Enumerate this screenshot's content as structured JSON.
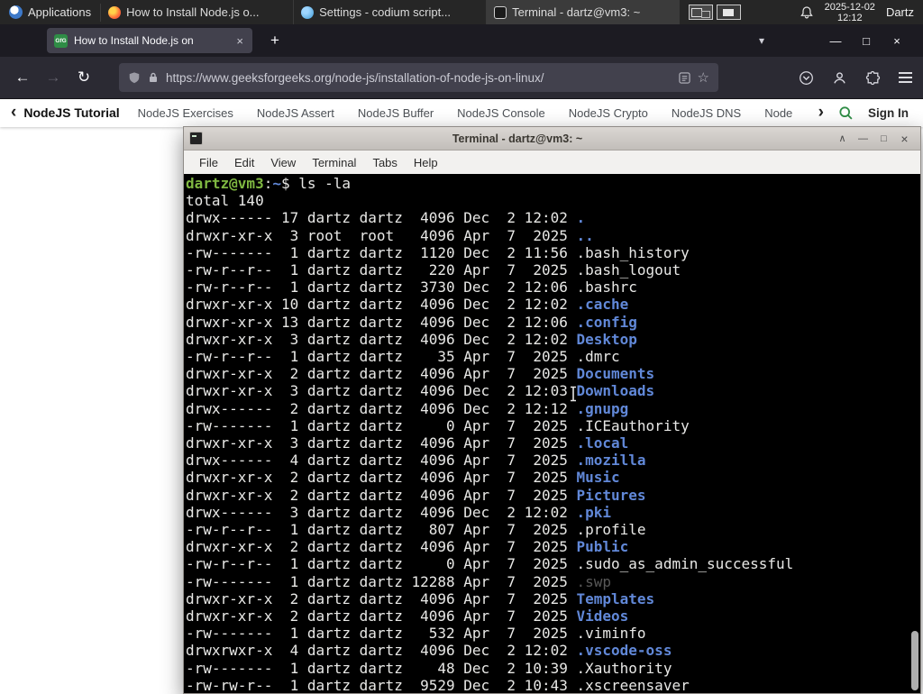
{
  "panel": {
    "applications_label": "Applications",
    "tasks": [
      {
        "title": "How to Install Node.js o...",
        "app": "firefox"
      },
      {
        "title": "Settings - codium script...",
        "app": "codium"
      },
      {
        "title": "Terminal - dartz@vm3: ~",
        "app": "terminal"
      }
    ],
    "clock": {
      "date": "2025-12-02",
      "time": "12:12"
    },
    "user": "Dartz"
  },
  "browser": {
    "tab": {
      "title": "How to Install Node.js on",
      "favicon": "GfG"
    },
    "url": "https://www.geeksforgeeks.org/node-js/installation-of-node-js-on-linux/"
  },
  "site_nav": {
    "active": "NodeJS Tutorial",
    "items": [
      "NodeJS Exercises",
      "NodeJS Assert",
      "NodeJS Buffer",
      "NodeJS Console",
      "NodeJS Crypto",
      "NodeJS DNS",
      "Node"
    ],
    "sign_in": "Sign In"
  },
  "terminal": {
    "window_title": "Terminal - dartz@vm3: ~",
    "menu": [
      "File",
      "Edit",
      "View",
      "Terminal",
      "Tabs",
      "Help"
    ],
    "prompt": {
      "user_host": "dartz@vm3",
      "separator": ":",
      "path": "~",
      "symbol": "$",
      "command": "ls -la"
    },
    "total": "total 140",
    "lines": [
      {
        "t": "drwx------ 17 dartz dartz  4096 Dec  2 12:02 ",
        "n": ".",
        "c": "dir"
      },
      {
        "t": "drwxr-xr-x  3 root  root   4096 Apr  7  2025 ",
        "n": "..",
        "c": "dir"
      },
      {
        "t": "-rw-------  1 dartz dartz  1120 Dec  2 11:56 ",
        "n": ".bash_history",
        "c": "file"
      },
      {
        "t": "-rw-r--r--  1 dartz dartz   220 Apr  7  2025 ",
        "n": ".bash_logout",
        "c": "file"
      },
      {
        "t": "-rw-r--r--  1 dartz dartz  3730 Dec  2 12:06 ",
        "n": ".bashrc",
        "c": "file"
      },
      {
        "t": "drwxr-xr-x 10 dartz dartz  4096 Dec  2 12:02 ",
        "n": ".cache",
        "c": "dir"
      },
      {
        "t": "drwxr-xr-x 13 dartz dartz  4096 Dec  2 12:06 ",
        "n": ".config",
        "c": "dir"
      },
      {
        "t": "drwxr-xr-x  3 dartz dartz  4096 Dec  2 12:02 ",
        "n": "Desktop",
        "c": "dir"
      },
      {
        "t": "-rw-r--r--  1 dartz dartz    35 Apr  7  2025 ",
        "n": ".dmrc",
        "c": "file"
      },
      {
        "t": "drwxr-xr-x  2 dartz dartz  4096 Apr  7  2025 ",
        "n": "Documents",
        "c": "dir"
      },
      {
        "t": "drwxr-xr-x  3 dartz dartz  4096 Dec  2 12:03 ",
        "n": "Downloads",
        "c": "dir"
      },
      {
        "t": "drwx------  2 dartz dartz  4096 Dec  2 12:12 ",
        "n": ".gnupg",
        "c": "dir"
      },
      {
        "t": "-rw-------  1 dartz dartz     0 Apr  7  2025 ",
        "n": ".ICEauthority",
        "c": "file"
      },
      {
        "t": "drwxr-xr-x  3 dartz dartz  4096 Apr  7  2025 ",
        "n": ".local",
        "c": "dir"
      },
      {
        "t": "drwx------  4 dartz dartz  4096 Apr  7  2025 ",
        "n": ".mozilla",
        "c": "dir"
      },
      {
        "t": "drwxr-xr-x  2 dartz dartz  4096 Apr  7  2025 ",
        "n": "Music",
        "c": "dir"
      },
      {
        "t": "drwxr-xr-x  2 dartz dartz  4096 Apr  7  2025 ",
        "n": "Pictures",
        "c": "dir"
      },
      {
        "t": "drwx------  3 dartz dartz  4096 Dec  2 12:02 ",
        "n": ".pki",
        "c": "dir"
      },
      {
        "t": "-rw-r--r--  1 dartz dartz   807 Apr  7  2025 ",
        "n": ".profile",
        "c": "file"
      },
      {
        "t": "drwxr-xr-x  2 dartz dartz  4096 Apr  7  2025 ",
        "n": "Public",
        "c": "dir"
      },
      {
        "t": "-rw-r--r--  1 dartz dartz     0 Apr  7  2025 ",
        "n": ".sudo_as_admin_successful",
        "c": "file"
      },
      {
        "t": "-rw-------  1 dartz dartz 12288 Apr  7  2025 ",
        "n": ".swp",
        "c": "dim"
      },
      {
        "t": "drwxr-xr-x  2 dartz dartz  4096 Apr  7  2025 ",
        "n": "Templates",
        "c": "dir"
      },
      {
        "t": "drwxr-xr-x  2 dartz dartz  4096 Apr  7  2025 ",
        "n": "Videos",
        "c": "dir"
      },
      {
        "t": "-rw-------  1 dartz dartz   532 Apr  7  2025 ",
        "n": ".viminfo",
        "c": "file"
      },
      {
        "t": "drwxrwxr-x  4 dartz dartz  4096 Dec  2 12:02 ",
        "n": ".vscode-oss",
        "c": "dir"
      },
      {
        "t": "-rw-------  1 dartz dartz    48 Dec  2 10:39 ",
        "n": ".Xauthority",
        "c": "file"
      },
      {
        "t": "-rw-rw-r--  1 dartz dartz  9529 Dec  2 10:43 ",
        "n": ".xscreensaver",
        "c": "file"
      }
    ]
  },
  "icons": {
    "back": "←",
    "forward": "→",
    "reload": "↻",
    "star": "☆",
    "new_tab": "+",
    "tab_close": "×",
    "window_min": "—",
    "window_max": "□",
    "window_close": "×",
    "tab_overflow": "▾",
    "term_shade": "∧",
    "term_min": "—",
    "term_max": "□",
    "term_close": "×",
    "nav_prev": "‹",
    "nav_next": "›"
  },
  "colors": {
    "gfg_green": "#2f8d46",
    "dir_blue": "#6188d8",
    "prompt_green": "#7fb841",
    "terminal_bg": "#000000",
    "panel_bg": "#262626"
  }
}
